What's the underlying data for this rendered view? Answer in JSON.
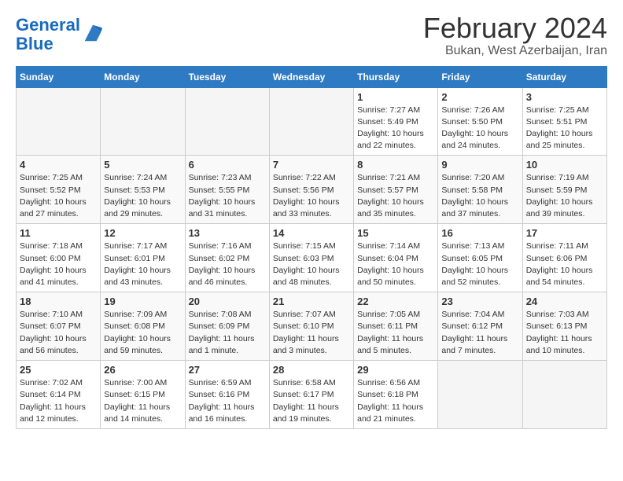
{
  "logo": {
    "text_general": "General",
    "text_blue": "Blue"
  },
  "header": {
    "month": "February 2024",
    "location": "Bukan, West Azerbaijan, Iran"
  },
  "days_of_week": [
    "Sunday",
    "Monday",
    "Tuesday",
    "Wednesday",
    "Thursday",
    "Friday",
    "Saturday"
  ],
  "weeks": [
    [
      {
        "day": "",
        "info": ""
      },
      {
        "day": "",
        "info": ""
      },
      {
        "day": "",
        "info": ""
      },
      {
        "day": "",
        "info": ""
      },
      {
        "day": "1",
        "info": "Sunrise: 7:27 AM\nSunset: 5:49 PM\nDaylight: 10 hours\nand 22 minutes."
      },
      {
        "day": "2",
        "info": "Sunrise: 7:26 AM\nSunset: 5:50 PM\nDaylight: 10 hours\nand 24 minutes."
      },
      {
        "day": "3",
        "info": "Sunrise: 7:25 AM\nSunset: 5:51 PM\nDaylight: 10 hours\nand 25 minutes."
      }
    ],
    [
      {
        "day": "4",
        "info": "Sunrise: 7:25 AM\nSunset: 5:52 PM\nDaylight: 10 hours\nand 27 minutes."
      },
      {
        "day": "5",
        "info": "Sunrise: 7:24 AM\nSunset: 5:53 PM\nDaylight: 10 hours\nand 29 minutes."
      },
      {
        "day": "6",
        "info": "Sunrise: 7:23 AM\nSunset: 5:55 PM\nDaylight: 10 hours\nand 31 minutes."
      },
      {
        "day": "7",
        "info": "Sunrise: 7:22 AM\nSunset: 5:56 PM\nDaylight: 10 hours\nand 33 minutes."
      },
      {
        "day": "8",
        "info": "Sunrise: 7:21 AM\nSunset: 5:57 PM\nDaylight: 10 hours\nand 35 minutes."
      },
      {
        "day": "9",
        "info": "Sunrise: 7:20 AM\nSunset: 5:58 PM\nDaylight: 10 hours\nand 37 minutes."
      },
      {
        "day": "10",
        "info": "Sunrise: 7:19 AM\nSunset: 5:59 PM\nDaylight: 10 hours\nand 39 minutes."
      }
    ],
    [
      {
        "day": "11",
        "info": "Sunrise: 7:18 AM\nSunset: 6:00 PM\nDaylight: 10 hours\nand 41 minutes."
      },
      {
        "day": "12",
        "info": "Sunrise: 7:17 AM\nSunset: 6:01 PM\nDaylight: 10 hours\nand 43 minutes."
      },
      {
        "day": "13",
        "info": "Sunrise: 7:16 AM\nSunset: 6:02 PM\nDaylight: 10 hours\nand 46 minutes."
      },
      {
        "day": "14",
        "info": "Sunrise: 7:15 AM\nSunset: 6:03 PM\nDaylight: 10 hours\nand 48 minutes."
      },
      {
        "day": "15",
        "info": "Sunrise: 7:14 AM\nSunset: 6:04 PM\nDaylight: 10 hours\nand 50 minutes."
      },
      {
        "day": "16",
        "info": "Sunrise: 7:13 AM\nSunset: 6:05 PM\nDaylight: 10 hours\nand 52 minutes."
      },
      {
        "day": "17",
        "info": "Sunrise: 7:11 AM\nSunset: 6:06 PM\nDaylight: 10 hours\nand 54 minutes."
      }
    ],
    [
      {
        "day": "18",
        "info": "Sunrise: 7:10 AM\nSunset: 6:07 PM\nDaylight: 10 hours\nand 56 minutes."
      },
      {
        "day": "19",
        "info": "Sunrise: 7:09 AM\nSunset: 6:08 PM\nDaylight: 10 hours\nand 59 minutes."
      },
      {
        "day": "20",
        "info": "Sunrise: 7:08 AM\nSunset: 6:09 PM\nDaylight: 11 hours\nand 1 minute."
      },
      {
        "day": "21",
        "info": "Sunrise: 7:07 AM\nSunset: 6:10 PM\nDaylight: 11 hours\nand 3 minutes."
      },
      {
        "day": "22",
        "info": "Sunrise: 7:05 AM\nSunset: 6:11 PM\nDaylight: 11 hours\nand 5 minutes."
      },
      {
        "day": "23",
        "info": "Sunrise: 7:04 AM\nSunset: 6:12 PM\nDaylight: 11 hours\nand 7 minutes."
      },
      {
        "day": "24",
        "info": "Sunrise: 7:03 AM\nSunset: 6:13 PM\nDaylight: 11 hours\nand 10 minutes."
      }
    ],
    [
      {
        "day": "25",
        "info": "Sunrise: 7:02 AM\nSunset: 6:14 PM\nDaylight: 11 hours\nand 12 minutes."
      },
      {
        "day": "26",
        "info": "Sunrise: 7:00 AM\nSunset: 6:15 PM\nDaylight: 11 hours\nand 14 minutes."
      },
      {
        "day": "27",
        "info": "Sunrise: 6:59 AM\nSunset: 6:16 PM\nDaylight: 11 hours\nand 16 minutes."
      },
      {
        "day": "28",
        "info": "Sunrise: 6:58 AM\nSunset: 6:17 PM\nDaylight: 11 hours\nand 19 minutes."
      },
      {
        "day": "29",
        "info": "Sunrise: 6:56 AM\nSunset: 6:18 PM\nDaylight: 11 hours\nand 21 minutes."
      },
      {
        "day": "",
        "info": ""
      },
      {
        "day": "",
        "info": ""
      }
    ]
  ]
}
